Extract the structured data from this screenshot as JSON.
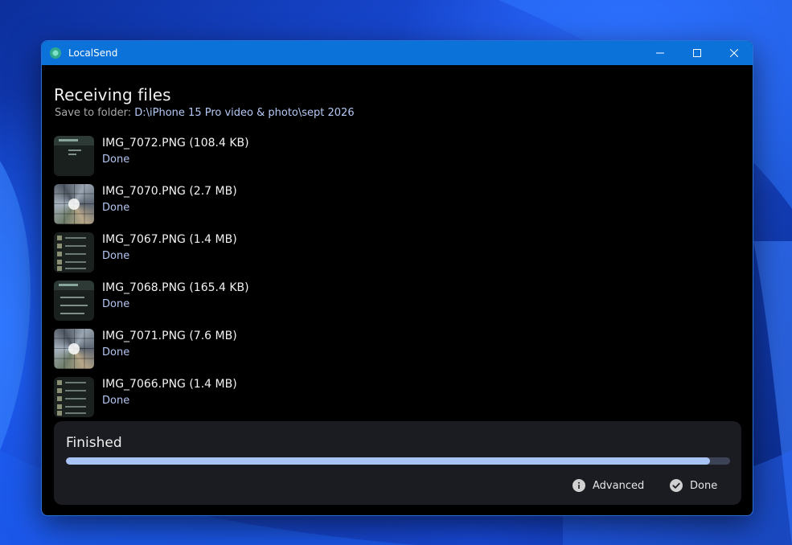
{
  "window": {
    "title": "LocalSend"
  },
  "page": {
    "title": "Receiving files",
    "save_label": "Save to folder:",
    "save_path": "D:\\iPhone 15 Pro video & photo\\sept 2026"
  },
  "files": [
    {
      "name": "IMG_7072.PNG (108.4 KB)",
      "status": "Done",
      "thumb": "dark-ui"
    },
    {
      "name": "IMG_7070.PNG (2.7 MB)",
      "status": "Done",
      "thumb": "photo-grid"
    },
    {
      "name": "IMG_7067.PNG (1.4 MB)",
      "status": "Done",
      "thumb": "list-ui"
    },
    {
      "name": "IMG_7068.PNG (165.4 KB)",
      "status": "Done",
      "thumb": "dark-ui"
    },
    {
      "name": "IMG_7071.PNG (7.6 MB)",
      "status": "Done",
      "thumb": "photo-grid"
    },
    {
      "name": "IMG_7066.PNG (1.4 MB)",
      "status": "Done",
      "thumb": "list-ui"
    }
  ],
  "panel": {
    "title": "Finished",
    "progress": 0.97,
    "advanced_label": "Advanced",
    "done_label": "Done"
  },
  "icons": {
    "app": "localsend-icon",
    "minimize": "minimize-icon",
    "maximize": "maximize-icon",
    "close": "close-icon",
    "info": "info-icon",
    "check": "check-circle-icon"
  },
  "colors": {
    "titlebar": "#0a72d8",
    "accent": "#a9c3f5",
    "status": "#b4c6f2",
    "panel": "#1b1c21"
  }
}
